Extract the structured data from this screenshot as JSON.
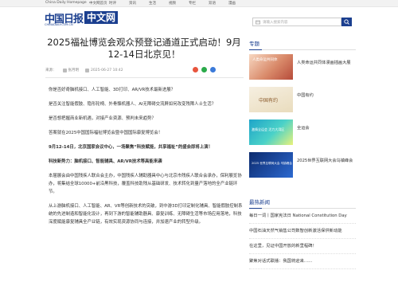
{
  "topbar": {
    "home": "China Daily Homepage",
    "nav": [
      "中文网首页",
      "时评",
      "资讯",
      "生活",
      "视频",
      "专栏",
      "双语",
      "漫画"
    ]
  },
  "logo": {
    "cn": "中国日报",
    "box": "中文网",
    "en": "CHINADAILY.COM.CN"
  },
  "search": {
    "placeholder": "请输入搜索内容"
  },
  "article": {
    "title": "2025福祉博览会观众预登记通道正式启动！9月12-14日北京见！",
    "source_label": "来源：",
    "author": "张月明",
    "date": "2025-06-27 10:42",
    "paragraphs": [
      {
        "text": "你是否好奇脑机接口、人工智能、3D打印、AR/VR技术最新进展？",
        "bold": false
      },
      {
        "text": "是否关注智能假肢、隐形轮椅、外骨骼机器人、AI无障碍交流屏如何改变残障人士生活？",
        "bold": false
      },
      {
        "text": "是否想把握商业新机遇，对接产业资源、预判未来趋势？",
        "bold": false
      },
      {
        "text": "答案就在2025中国国际福祉博览会暨中国国际康复博览会！",
        "bold": false
      },
      {
        "text": "9月12-14日，北京国家会议中心，一场聚焦“科技赋能，共享福祉”的盛会即将上演！",
        "bold": true
      },
      {
        "text": "科技新势力：脑机接口、智能辅具、AR/VR技术等高能来袭",
        "bold": true
      },
      {
        "text": "本届展会由中国残疾人联合会主办，中国残疾人辅助器具中心与北京市残疾人联合会承办，保利展览协办，将集结全球10000+前沿黑科技，覆盖科技助残从基础研发、技术转化到量产落地的全产业链环节。",
        "bold": false
      },
      {
        "text": "从上游脑机接口、人工智能、AR、VR等创新技术的突破，到中游3D打印定制化辅具、智能假肢控制系统的先进制造和智能化设计，再到下游的智能辅助器具、康复训练、无障碍生活等市场应用落地，科技深度赋能康复辅具全产业链，有效实现资源协同与连接，并加速产业的转型升级。",
        "bold": false
      }
    ]
  },
  "aside": {
    "special_title": "专题",
    "topics": [
      {
        "label": "人类命运共同体漫画插画大展",
        "thumb_text": "人类命运共同体"
      },
      {
        "label": "中国有约",
        "thumb_text": "中国有约"
      },
      {
        "label": "全运会",
        "thumb_text": "激情全运会 活力大湾区"
      },
      {
        "label": "2025世界互联网大会乌镇峰会",
        "thumb_text": "2025 世界互联网大会 乌镇峰会"
      }
    ],
    "hot_title": "最热新闻",
    "hot_items": [
      "每日一词丨国家宪法日 National Constitution Day",
      "中国石油天然气销售公司数智创新激活保供新动能",
      "在这里，见证中国开放的新里程碑！",
      "聚焦对话式联播：我国将迎来……"
    ]
  },
  "colors": {
    "brand_blue": "#1b3f8f",
    "share_red": "#e8553d",
    "share_green": "#2aaa4a",
    "share_blue": "#3b7ad9"
  }
}
